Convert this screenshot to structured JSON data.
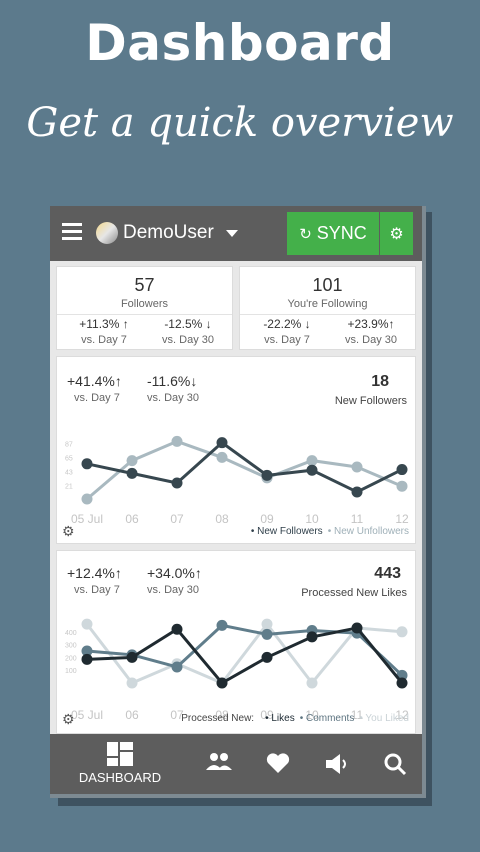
{
  "promo": {
    "title": "Dashboard",
    "subtitle": "Get a quick overview"
  },
  "topbar": {
    "user_name": "DemoUser",
    "sync_label": "SYNC"
  },
  "stats": [
    {
      "value": "57",
      "label": "Followers",
      "deltas": [
        {
          "value": "+11.3% ↑",
          "sub": "vs. Day 7"
        },
        {
          "value": "-12.5% ↓",
          "sub": "vs. Day 30"
        }
      ]
    },
    {
      "value": "101",
      "label": "You're Following",
      "deltas": [
        {
          "value": "-22.2% ↓",
          "sub": "vs. Day 7"
        },
        {
          "value": "+23.9%↑",
          "sub": "vs. Day 30"
        }
      ]
    }
  ],
  "followers_card": {
    "delta1": "+41.4%↑",
    "sub1": "vs. Day 7",
    "delta2": "-11.6%↓",
    "sub2": "vs. Day 30",
    "big": "18",
    "name": "New Followers",
    "legend": [
      {
        "label": "• New Followers",
        "color": "#2f3f4a"
      },
      {
        "label": "• New Unfollowers",
        "color": "#9fb0b8"
      }
    ]
  },
  "likes_card": {
    "delta1": "+12.4%↑",
    "sub1": "vs. Day 7",
    "delta2": "+34.0%↑",
    "sub2": "vs. Day 30",
    "big": "443",
    "name": "Processed New Likes",
    "legend_prefix": "Processed New:",
    "legend": [
      {
        "label": "• Likes",
        "color": "#1d2a33"
      },
      {
        "label": "• Comments",
        "color": "#5d7480"
      },
      {
        "label": "• You Liked",
        "color": "#c9d2d6"
      }
    ]
  },
  "chart_data": [
    {
      "type": "line",
      "x": [
        "05 Jul",
        "06",
        "07",
        "08",
        "09",
        "10",
        "11",
        "12"
      ],
      "y_ticks": [
        "87",
        "65",
        "43",
        "21"
      ],
      "ylim": [
        0,
        100
      ],
      "grid": false,
      "legend_position": "bottom-right",
      "series": [
        {
          "name": "New Followers",
          "color": "#37474f",
          "values": [
            55,
            40,
            25,
            88,
            37,
            45,
            11,
            46
          ]
        },
        {
          "name": "New Unfollowers",
          "color": "#a9b9c0",
          "values": [
            0,
            60,
            90,
            65,
            33,
            60,
            50,
            20
          ]
        }
      ]
    },
    {
      "type": "line",
      "x": [
        "05 Jul",
        "06",
        "07",
        "08",
        "09",
        "10",
        "11",
        "12"
      ],
      "y_ticks": [
        "400",
        "300",
        "200",
        "100"
      ],
      "ylim": [
        0,
        500
      ],
      "grid": false,
      "legend_position": "bottom-right",
      "series": [
        {
          "name": "Likes",
          "color": "#1f2a30",
          "values": [
            185,
            200,
            420,
            0,
            200,
            360,
            430,
            0
          ]
        },
        {
          "name": "Comments",
          "color": "#607d8b",
          "values": [
            250,
            220,
            125,
            450,
            380,
            410,
            390,
            60
          ]
        },
        {
          "name": "You Liked",
          "color": "#cfd8dc",
          "values": [
            460,
            0,
            150,
            0,
            460,
            0,
            430,
            400
          ]
        }
      ]
    }
  ],
  "nav": {
    "dashboard_label": "DASHBOARD"
  }
}
